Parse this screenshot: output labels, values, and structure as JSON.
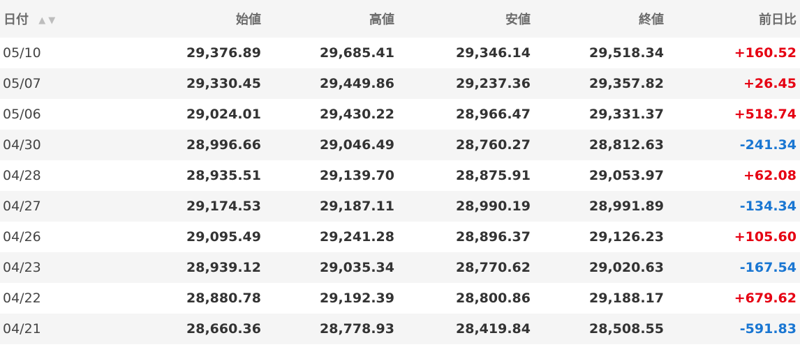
{
  "table": {
    "headers": {
      "date": "日付",
      "open": "始値",
      "high": "高値",
      "low": "安値",
      "close": "終値",
      "change": "前日比"
    },
    "sort_up_icon": "triangle-up-icon",
    "sort_down_icon": "triangle-down-icon",
    "rows": [
      {
        "date": "05/10",
        "open": "29,376.89",
        "high": "29,685.41",
        "low": "29,346.14",
        "close": "29,518.34",
        "change": "+160.52",
        "direction": "up"
      },
      {
        "date": "05/07",
        "open": "29,330.45",
        "high": "29,449.86",
        "low": "29,237.36",
        "close": "29,357.82",
        "change": "+26.45",
        "direction": "up"
      },
      {
        "date": "05/06",
        "open": "29,024.01",
        "high": "29,430.22",
        "low": "28,966.47",
        "close": "29,331.37",
        "change": "+518.74",
        "direction": "up"
      },
      {
        "date": "04/30",
        "open": "28,996.66",
        "high": "29,046.49",
        "low": "28,760.27",
        "close": "28,812.63",
        "change": "-241.34",
        "direction": "down"
      },
      {
        "date": "04/28",
        "open": "28,935.51",
        "high": "29,139.70",
        "low": "28,875.91",
        "close": "29,053.97",
        "change": "+62.08",
        "direction": "up"
      },
      {
        "date": "04/27",
        "open": "29,174.53",
        "high": "29,187.11",
        "low": "28,990.19",
        "close": "28,991.89",
        "change": "-134.34",
        "direction": "down"
      },
      {
        "date": "04/26",
        "open": "29,095.49",
        "high": "29,241.28",
        "low": "28,896.37",
        "close": "29,126.23",
        "change": "+105.60",
        "direction": "up"
      },
      {
        "date": "04/23",
        "open": "28,939.12",
        "high": "29,035.34",
        "low": "28,770.62",
        "close": "29,020.63",
        "change": "-167.54",
        "direction": "down"
      },
      {
        "date": "04/22",
        "open": "28,880.78",
        "high": "29,192.39",
        "low": "28,800.86",
        "close": "29,188.17",
        "change": "+679.62",
        "direction": "up"
      },
      {
        "date": "04/21",
        "open": "28,660.36",
        "high": "28,778.93",
        "low": "28,419.84",
        "close": "28,508.55",
        "change": "-591.83",
        "direction": "down"
      }
    ]
  },
  "colors": {
    "up": "#e60012",
    "down": "#1976d2",
    "header_bg": "#f5f5f5",
    "stripe_bg": "#f5f5f5"
  }
}
